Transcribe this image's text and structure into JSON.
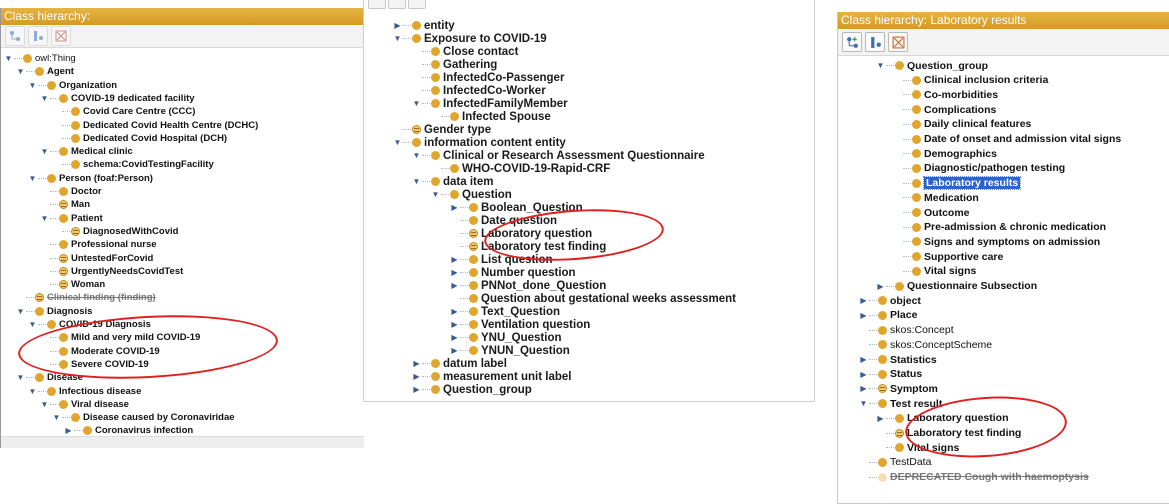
{
  "panel_left": {
    "title": "Class hierarchy:",
    "toolbar": [
      {
        "icon": "add-subclass-icon"
      },
      {
        "icon": "add-sibling-icon"
      },
      {
        "icon": "delete-class-icon"
      }
    ],
    "rows": [
      {
        "label": "owl:Thing",
        "toggle": "▼",
        "indent": 0,
        "style": "owl"
      },
      {
        "label": "Agent",
        "toggle": "▼",
        "indent": 1
      },
      {
        "label": "Organization",
        "toggle": "▼",
        "indent": 2
      },
      {
        "label": "COVID-19 dedicated facility",
        "toggle": "▼",
        "indent": 3
      },
      {
        "label": "Covid Care Centre (CCC)",
        "toggle": "",
        "indent": 4
      },
      {
        "label": "Dedicated Covid Health Centre (DCHC)",
        "toggle": "",
        "indent": 4
      },
      {
        "label": "Dedicated Covid Hospital (DCH)",
        "toggle": "",
        "indent": 4
      },
      {
        "label": "Medical clinic",
        "toggle": "▼",
        "indent": 3
      },
      {
        "label": "schema:CovidTestingFacility",
        "toggle": "",
        "indent": 4
      },
      {
        "label": "Person (foaf:Person)",
        "toggle": "▼",
        "indent": 2
      },
      {
        "label": "Doctor",
        "toggle": "",
        "indent": 3
      },
      {
        "label": "Man",
        "toggle": "",
        "indent": 3,
        "dot": "eq"
      },
      {
        "label": "Patient",
        "toggle": "▼",
        "indent": 3
      },
      {
        "label": "DiagnosedWithCovid",
        "toggle": "",
        "indent": 4,
        "dot": "eq"
      },
      {
        "label": "Professional nurse",
        "toggle": "",
        "indent": 3
      },
      {
        "label": "UntestedForCovid",
        "toggle": "",
        "indent": 3,
        "dot": "eq"
      },
      {
        "label": "UrgentlyNeedsCovidTest",
        "toggle": "",
        "indent": 3,
        "dot": "eq"
      },
      {
        "label": "Woman",
        "toggle": "",
        "indent": 3,
        "dot": "eq"
      },
      {
        "label": "Clinical finding (finding)",
        "toggle": "",
        "indent": 1,
        "dot": "eq",
        "style": "strike"
      },
      {
        "label": "Diagnosis",
        "toggle": "▼",
        "indent": 1
      },
      {
        "label": "COVID-19 Diagnosis",
        "toggle": "▼",
        "indent": 2
      },
      {
        "label": "Mild and very mild COVID-19",
        "toggle": "",
        "indent": 3
      },
      {
        "label": "Moderate COVID-19",
        "toggle": "",
        "indent": 3
      },
      {
        "label": "Severe COVID-19",
        "toggle": "",
        "indent": 3
      },
      {
        "label": "Disease",
        "toggle": "▼",
        "indent": 1
      },
      {
        "label": "Infectious disease",
        "toggle": "▼",
        "indent": 2
      },
      {
        "label": "Viral disease",
        "toggle": "▼",
        "indent": 3
      },
      {
        "label": "Disease caused by Coronaviridae",
        "toggle": "▼",
        "indent": 4
      },
      {
        "label": "Coronavirus infection",
        "toggle": "▶",
        "indent": 5
      }
    ]
  },
  "panel_middle": {
    "toolbar": [
      {
        "icon": "add-subclass-icon"
      },
      {
        "icon": "add-sibling-icon"
      },
      {
        "icon": "delete-class-icon"
      }
    ],
    "rows": [
      {
        "label": "entity",
        "toggle": "▶",
        "indent": 0
      },
      {
        "label": "Exposure to COVID-19",
        "toggle": "▼",
        "indent": 0
      },
      {
        "label": "Close contact",
        "toggle": "",
        "indent": 1
      },
      {
        "label": "Gathering",
        "toggle": "",
        "indent": 1
      },
      {
        "label": "InfectedCo-Passenger",
        "toggle": "",
        "indent": 1
      },
      {
        "label": "InfectedCo-Worker",
        "toggle": "",
        "indent": 1
      },
      {
        "label": "InfectedFamilyMember",
        "toggle": "▼",
        "indent": 1
      },
      {
        "label": "Infected Spouse",
        "toggle": "",
        "indent": 2
      },
      {
        "label": "Gender type",
        "toggle": "",
        "indent": 0,
        "dot": "eq"
      },
      {
        "label": "information content entity",
        "toggle": "▼",
        "indent": 0
      },
      {
        "label": "Clinical or Research Assessment Questionnaire",
        "toggle": "▼",
        "indent": 1
      },
      {
        "label": "WHO-COVID-19-Rapid-CRF",
        "toggle": "",
        "indent": 2
      },
      {
        "label": "data item",
        "toggle": "▼",
        "indent": 1
      },
      {
        "label": "Question",
        "toggle": "▼",
        "indent": 2
      },
      {
        "label": "Boolean_Question",
        "toggle": "▶",
        "indent": 3
      },
      {
        "label": "Date question",
        "toggle": "",
        "indent": 3
      },
      {
        "label": "Laboratory question",
        "toggle": "",
        "indent": 3,
        "dot": "eq"
      },
      {
        "label": "Laboratory test finding",
        "toggle": "",
        "indent": 3,
        "dot": "eq"
      },
      {
        "label": "List question",
        "toggle": "▶",
        "indent": 3
      },
      {
        "label": "Number question",
        "toggle": "▶",
        "indent": 3
      },
      {
        "label": "PNNot_done_Question",
        "toggle": "▶",
        "indent": 3
      },
      {
        "label": "Question about gestational weeks assessment",
        "toggle": "",
        "indent": 3
      },
      {
        "label": "Text_Question",
        "toggle": "▶",
        "indent": 3
      },
      {
        "label": "Ventilation question",
        "toggle": "▶",
        "indent": 3
      },
      {
        "label": "YNU_Question",
        "toggle": "▶",
        "indent": 3
      },
      {
        "label": "YNUN_Question",
        "toggle": "▶",
        "indent": 3
      },
      {
        "label": "datum label",
        "toggle": "▶",
        "indent": 1
      },
      {
        "label": "measurement unit label",
        "toggle": "▶",
        "indent": 1
      },
      {
        "label": "Question_group",
        "toggle": "▶",
        "indent": 1
      }
    ]
  },
  "panel_right": {
    "title": "Class hierarchy: Laboratory results",
    "toolbar": [
      {
        "icon": "add-subclass-icon"
      },
      {
        "icon": "add-sibling-icon"
      },
      {
        "icon": "delete-class-icon"
      }
    ],
    "rows": [
      {
        "label": "Question_group",
        "toggle": "▼",
        "indent": 1
      },
      {
        "label": "Clinical inclusion criteria",
        "toggle": "",
        "indent": 2
      },
      {
        "label": "Co-morbidities",
        "toggle": "",
        "indent": 2
      },
      {
        "label": "Complications",
        "toggle": "",
        "indent": 2
      },
      {
        "label": "Daily clinical features",
        "toggle": "",
        "indent": 2
      },
      {
        "label": "Date of onset and admission vital signs",
        "toggle": "",
        "indent": 2
      },
      {
        "label": "Demographics",
        "toggle": "",
        "indent": 2
      },
      {
        "label": "Diagnostic/pathogen testing",
        "toggle": "",
        "indent": 2
      },
      {
        "label": "Laboratory results",
        "toggle": "",
        "indent": 2,
        "style": "sel"
      },
      {
        "label": "Medication",
        "toggle": "",
        "indent": 2
      },
      {
        "label": "Outcome",
        "toggle": "",
        "indent": 2
      },
      {
        "label": "Pre-admission & chronic medication",
        "toggle": "",
        "indent": 2
      },
      {
        "label": "Signs and symptoms on admission",
        "toggle": "",
        "indent": 2
      },
      {
        "label": "Supportive care",
        "toggle": "",
        "indent": 2
      },
      {
        "label": "Vital signs",
        "toggle": "",
        "indent": 2
      },
      {
        "label": "Questionnaire Subsection",
        "toggle": "▶",
        "indent": 1
      },
      {
        "label": "object",
        "toggle": "▶",
        "indent": 0
      },
      {
        "label": "Place",
        "toggle": "▶",
        "indent": 0
      },
      {
        "label": "skos:Concept",
        "toggle": "",
        "indent": 0,
        "style": "plain"
      },
      {
        "label": "skos:ConceptScheme",
        "toggle": "",
        "indent": 0,
        "style": "plain"
      },
      {
        "label": "Statistics",
        "toggle": "▶",
        "indent": 0
      },
      {
        "label": "Status",
        "toggle": "▶",
        "indent": 0
      },
      {
        "label": "Symptom",
        "toggle": "▶",
        "indent": 0,
        "dot": "eq"
      },
      {
        "label": "Test result",
        "toggle": "▼",
        "indent": 0
      },
      {
        "label": "Laboratory question",
        "toggle": "▶",
        "indent": 1
      },
      {
        "label": "Laboratory test finding",
        "toggle": "",
        "indent": 1,
        "dot": "eq"
      },
      {
        "label": "Vital signs",
        "toggle": "",
        "indent": 1
      },
      {
        "label": "TestData",
        "toggle": "",
        "indent": 0,
        "style": "plain"
      },
      {
        "label": "DEPRECATED Cough with haemoptysis",
        "toggle": "",
        "indent": 0,
        "dot": "faded",
        "style": "strike"
      }
    ]
  },
  "colors": {
    "title_bar": "#d9a431",
    "class_dot": "#e0a52d",
    "selection": "#2d63cf",
    "annotation_ellipse": "#e02020"
  }
}
